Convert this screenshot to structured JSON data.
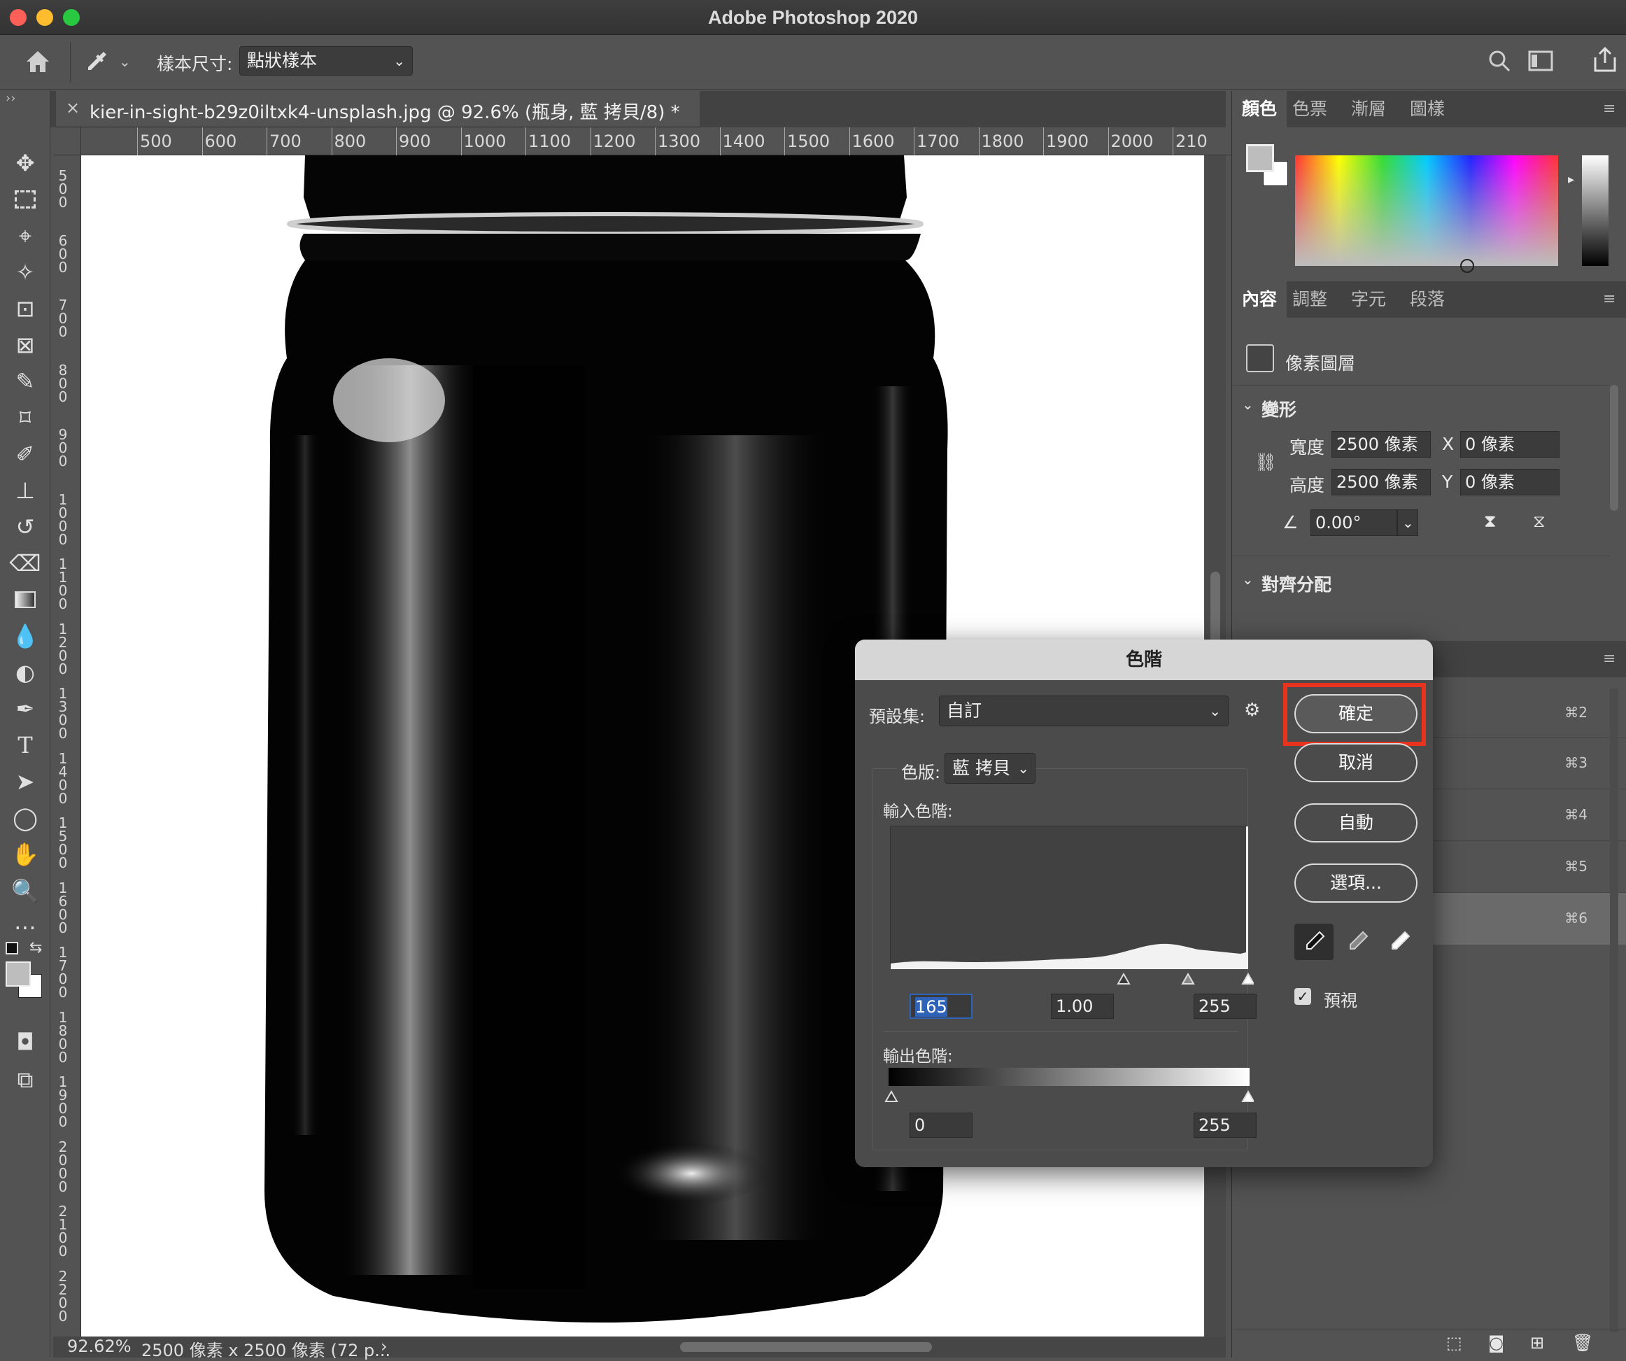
{
  "window": {
    "title": "Adobe Photoshop 2020"
  },
  "options_bar": {
    "sample_size_label": "樣本尺寸:",
    "sample_size_value": "點狀樣本"
  },
  "document": {
    "tab_title": "kier-in-sight-b29z0iltxk4-unsplash.jpg @ 92.6% (瓶身, 藍 拷貝/8) *"
  },
  "ruler": {
    "h_ticks": [
      "500",
      "600",
      "700",
      "800",
      "900",
      "1000",
      "1100",
      "1200",
      "1300",
      "1400",
      "1500",
      "1600",
      "1700",
      "1800",
      "1900",
      "2000",
      "210"
    ],
    "v_ticks": [
      "500",
      "600",
      "700",
      "800",
      "900",
      "1000",
      "1100",
      "1200",
      "1300",
      "1400",
      "1500",
      "1600",
      "1700",
      "1800",
      "1900",
      "2000",
      "2100",
      "2200"
    ]
  },
  "status": {
    "zoom": "92.62%",
    "doc_size": "2500 像素 x 2500 像素 (72 p..."
  },
  "color_panel": {
    "tabs": [
      "顏色",
      "色票",
      "漸層",
      "圖樣"
    ]
  },
  "properties_panel": {
    "tabs": [
      "內容",
      "調整",
      "字元",
      "段落"
    ],
    "layer_type": "像素圖層",
    "transform_section": "變形",
    "width_label": "寬度",
    "width_value": "2500 像素",
    "height_label": "高度",
    "height_value": "2500 像素",
    "x_label": "X",
    "x_value": "0 像素",
    "y_label": "Y",
    "y_value": "0 像素",
    "angle_value": "0.00°",
    "align_section": "對齊分配"
  },
  "channels_panel": {
    "shortcuts": [
      "⌘2",
      "⌘3",
      "⌘4",
      "⌘5",
      "⌘6"
    ]
  },
  "levels_dialog": {
    "title": "色階",
    "preset_label": "預設集:",
    "preset_value": "自訂",
    "channel_label": "色版:",
    "channel_value": "藍 拷貝",
    "input_label": "輸入色階:",
    "input_black": "165",
    "input_gamma": "1.00",
    "input_white": "255",
    "output_label": "輸出色階:",
    "output_black": "0",
    "output_white": "255",
    "ok": "確定",
    "cancel": "取消",
    "auto": "自動",
    "options": "選項...",
    "preview_label": "預視",
    "preview_checked": true
  },
  "colors": {
    "highlight_box": "#e8331f",
    "accent": "#2e63b8"
  }
}
